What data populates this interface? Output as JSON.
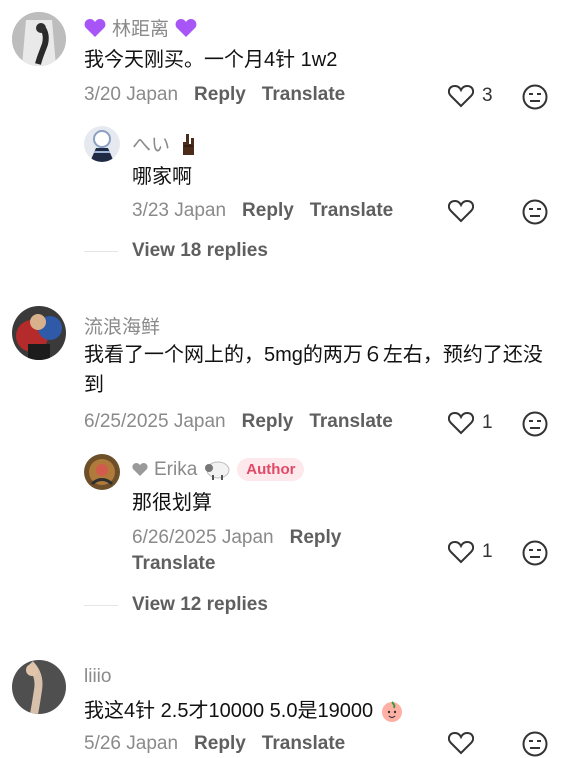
{
  "comments": [
    {
      "user": "林距离",
      "text": "我今天刚买。一个月4针 1w2",
      "date": "3/20",
      "region": "Japan",
      "reply_label": "Reply",
      "translate_label": "Translate",
      "likes": "3",
      "replies": [
        {
          "user": "へい",
          "text": "哪家啊",
          "date": "3/23",
          "region": "Japan",
          "reply_label": "Reply",
          "translate_label": "Translate"
        }
      ],
      "view_replies": "View 18 replies"
    },
    {
      "user": "流浪海鲜",
      "text": "我看了一个网上的，5mg的两万６左右，预约了还没到",
      "date": "6/25/2025",
      "region": "Japan",
      "reply_label": "Reply",
      "translate_label": "Translate",
      "likes": "1",
      "replies": [
        {
          "user": "Erika",
          "badge": "Author",
          "text": "那很划算",
          "date": "6/26/2025",
          "region": "Japan",
          "reply_label": "Reply",
          "translate_label": "Translate",
          "likes": "1"
        }
      ],
      "view_replies": "View 12 replies"
    },
    {
      "user": "liiio",
      "text": "我这4针 2.5才10000 5.0是19000",
      "date": "5/26",
      "region": "Japan",
      "reply_label": "Reply",
      "translate_label": "Translate"
    }
  ],
  "icons": {
    "like": "heart-outline-icon",
    "dislike": "dislike-face-icon",
    "purple_heart": "purple-heart-emoji",
    "rock_hand": "rock-hand-emoji",
    "sheep": "sheep-emoji",
    "peach": "peach-emoji"
  },
  "colors": {
    "author_badge_bg": "#fde8ec",
    "author_badge_text": "#e04a66",
    "purple_heart": "#a855f7"
  }
}
